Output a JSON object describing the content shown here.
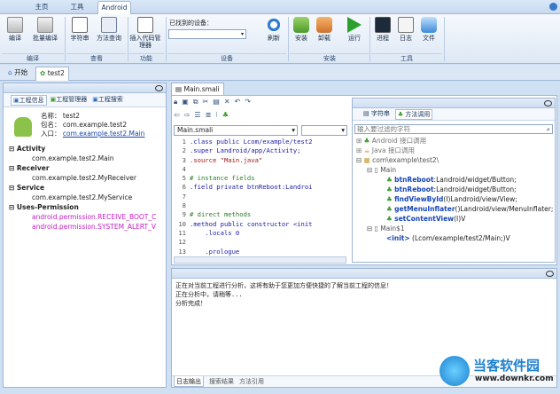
{
  "ribbon_tabs": [
    "主页",
    "工具",
    "Android"
  ],
  "ribbon": {
    "btn_compile": "编译",
    "btn_batch_compile": "批量编译",
    "btn_string": "字符串",
    "btn_method_query": "方法查询",
    "btn_insert_code": "插入代码管理器",
    "device_label": "已找到的设备：",
    "btn_refresh": "刷新",
    "btn_install": "安装",
    "btn_uninstall": "卸载",
    "btn_run": "运行",
    "btn_process": "进程",
    "btn_log": "日志",
    "btn_file": "文件",
    "grp_compile": "编译",
    "grp_view": "查看",
    "grp_function": "功能",
    "grp_device": "设备",
    "grp_install": "安装",
    "grp_tools": "工具"
  },
  "doc_tabs": {
    "start": "开始",
    "test2": "test2"
  },
  "left": {
    "tabs": [
      "工程信息",
      "工程管理器",
      "工程搜索"
    ],
    "name_label": "名称：",
    "name": "test2",
    "pkg_label": "包名：",
    "pkg": "com.example.test2",
    "entry_label": "入口：",
    "entry": "com.example.test2.Main",
    "activity_h": "Activity",
    "activity": "com.example.test2.Main",
    "receiver_h": "Receiver",
    "receiver": "com.example.test2.MyReceiver",
    "service_h": "Service",
    "service": "com.example.test2.MyService",
    "perm_h": "Uses-Permission",
    "perm1": "android.permission.RECEIVE_BOOT_C",
    "perm2": "android.permission.SYSTEM_ALERT_V"
  },
  "editor": {
    "tab": "Main.smali",
    "file_select": "Main.smali",
    "lines": [
      {
        "n": "1",
        "t": ".class public Lcom/example/test2"
      },
      {
        "n": "2",
        "t": ".super Landroid/app/Activity;"
      },
      {
        "n": "3",
        "t": ".source \"Main.java\""
      },
      {
        "n": "4",
        "t": ""
      },
      {
        "n": "5",
        "t": "# instance fields"
      },
      {
        "n": "6",
        "t": ".field private btnReboot:Landroi"
      },
      {
        "n": "7",
        "t": ""
      },
      {
        "n": "8",
        "t": ""
      },
      {
        "n": "9",
        "t": "# direct methods"
      },
      {
        "n": "10",
        "t": ".method public constructor <init"
      },
      {
        "n": "11",
        "t": "    .locals 0"
      },
      {
        "n": "12",
        "t": ""
      },
      {
        "n": "13",
        "t": "    .prologue"
      }
    ]
  },
  "right": {
    "tab_string": "字符串",
    "tab_method": "方法调用",
    "filter_placeholder": "输入要过滤的字符",
    "android_api": "Android 接口调用",
    "java_api": "Java 接口调用",
    "pkg_node": "com\\example\\test2\\",
    "main_node": "Main",
    "m1a": "btnReboot",
    "m1b": ":Landroid/widget/Button;",
    "m2a": "btnReboot",
    "m2b": ":Landroid/widget/Button;",
    "m3a": "findViewById",
    "m3b": "(I)Landroid/view/View;",
    "m4a": "getMenuInflater",
    "m4b": "()Landroid/view/MenuInflater;",
    "m5a": "setContentView",
    "m5b": "(I)V",
    "main1_node": "Main$1",
    "m6a": "<init>",
    "m6b": " (Lcom/example/test2/Main;)V"
  },
  "log": {
    "lines": [
      "正在对当前工程进行分析，这将有助于您更加方便快捷的了解当前工程的信息！",
      "正在分析中，请稍等...",
      "分析完成！"
    ],
    "tabs": [
      "日志输出",
      "搜索结果",
      "方法引用"
    ]
  },
  "watermark": {
    "cn": "当客软件园",
    "url": "www.downkr.com"
  }
}
